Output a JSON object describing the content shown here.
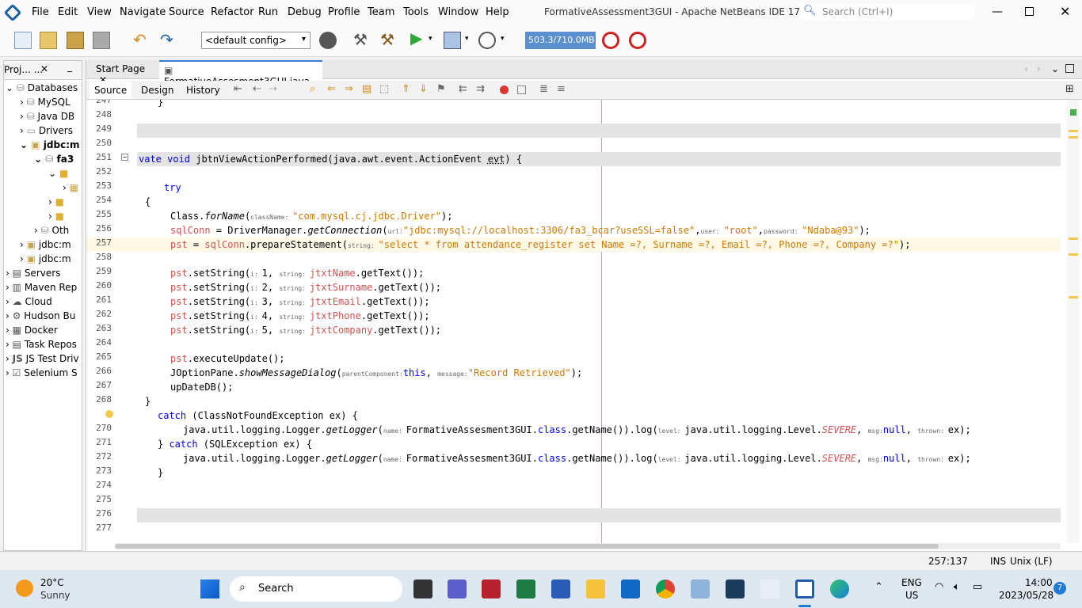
{
  "window": {
    "title": "FormativeAssessment3GUI - Apache NetBeans IDE 17",
    "search_placeholder": "Search (Ctrl+I)"
  },
  "menu": [
    "File",
    "Edit",
    "View",
    "Navigate",
    "Source",
    "Refactor",
    "Run",
    "Debug",
    "Profile",
    "Team",
    "Tools",
    "Window",
    "Help"
  ],
  "toolbar": {
    "config": "<default config>",
    "memory": "503.3/710.0MB"
  },
  "left_panel": {
    "tab": "Proj... ...",
    "items": [
      "Databases",
      "MySQL",
      "Java DB",
      "Drivers",
      "jdbc:m",
      "fa3",
      "Oth",
      "jdbc:m",
      "jdbc:m",
      "Servers",
      "Maven Rep",
      "Cloud",
      "Hudson Bu",
      "Docker",
      "Task Repos",
      "JS Test Driv",
      "Selenium S"
    ]
  },
  "editor": {
    "tabs": [
      "Start Page",
      "FormativeAssesment3GUI.java"
    ],
    "subtabs": [
      "Source",
      "Design",
      "History"
    ]
  },
  "status": {
    "position": "257:137",
    "mode": "INS",
    "eol": "Unix (LF)"
  },
  "taskbar": {
    "weather_temp": "20°C",
    "weather_desc": "Sunny",
    "search_label": "Search",
    "lang1": "ENG",
    "lang2": "US",
    "time": "14:00",
    "date": "2023/05/28",
    "badge": "7"
  },
  "colors": {
    "accent": "#1e7bd6",
    "keyword": "#0000e6",
    "field": "#d25252",
    "string": "#ce7b00"
  }
}
